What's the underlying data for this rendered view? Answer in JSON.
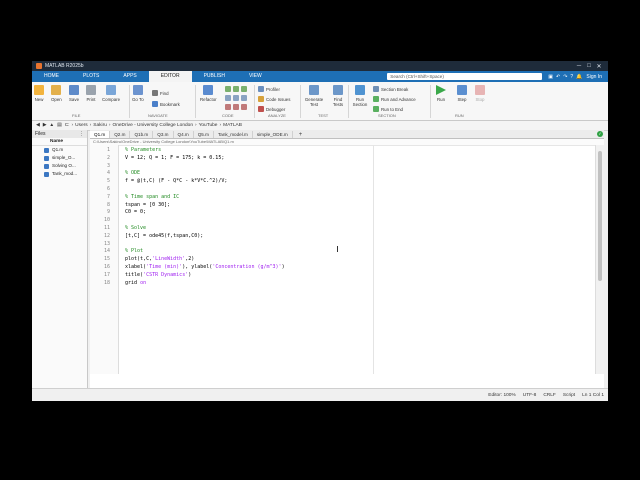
{
  "window": {
    "title": "MATLAB R2025b",
    "controls": [
      "─",
      "□",
      "✕"
    ]
  },
  "top_tabs": [
    {
      "label": "HOME",
      "active": false
    },
    {
      "label": "PLOTS",
      "active": false
    },
    {
      "label": "APPS",
      "active": false
    },
    {
      "label": "EDITOR",
      "active": true
    },
    {
      "label": "PUBLISH",
      "active": false
    },
    {
      "label": "VIEW",
      "active": false
    }
  ],
  "search": {
    "placeholder": "Search (Ctrl+Shift+Space)"
  },
  "signin": {
    "label": "Sign In"
  },
  "ribbon": {
    "file": {
      "new": "New",
      "open": "Open",
      "save": "Save",
      "print": "Print",
      "compare": "Compare",
      "section": "FILE"
    },
    "navigate": {
      "goto": "Go To",
      "find": "Find",
      "bookmark": "Bookmark",
      "section": "NAVIGATE"
    },
    "code": {
      "refactor": "Refactor",
      "section": "CODE"
    },
    "analyze": {
      "profiler": "Profiler",
      "code_issues": "Code Issues",
      "debugger": "Debugger",
      "section": "ANALYZE"
    },
    "test": {
      "generate": "Generate Test",
      "find_tests": "Find Tests",
      "section": "TEST"
    },
    "section_grp": {
      "run_section": "Run Section",
      "section_break": "Section Break",
      "run_advance": "Run and Advance",
      "run_end": "Run to End",
      "section": "SECTION"
    },
    "run": {
      "run": "Run",
      "step": "Step",
      "stop": "Stop",
      "section": "RUN"
    }
  },
  "address": {
    "crumbs": [
      "C:",
      "Users",
      "Sakiru",
      "OneDrive - University College London",
      "YouTube",
      "MATLAB"
    ]
  },
  "files_panel": {
    "title": "Files",
    "column": "Name",
    "items": [
      "Q1.m",
      "simple_O...",
      "Solving O...",
      "Tank_mod..."
    ]
  },
  "editor": {
    "tabs": [
      "Q1.m",
      "Q2.m",
      "Q1b.m",
      "Q3.m",
      "Q4.m",
      "Q5.m",
      "Tank_model.m",
      "simple_ODE.m"
    ],
    "active_tab": "Q1.m",
    "path": "C:\\Users\\Sakiru\\OneDrive - University College London\\YouTube\\MATLAB\\Q1.m",
    "lines": [
      "% Parameters",
      "V = 12; Q = 1; F = 175; k = 0.15;",
      "",
      "% ODE",
      "f = @(t,C) (F - Q*C - k*V*C.^2)/V;",
      "",
      "% Time span and IC",
      "tspan = [0 30];",
      "C0 = 0;",
      "",
      "% Solve",
      "[t,C] = ode45(f,tspan,C0);",
      "",
      "% Plot",
      "plot(t,C,'LineWidth',2)",
      "xlabel('Time (min)'), ylabel('Concentration (g/m^3)')",
      "title('CSTR Dynamics')",
      "grid on"
    ]
  },
  "status": {
    "zoom": "Editor: 100%",
    "encoding": "UTF-8",
    "eol": "CRLF",
    "type": "Script",
    "position": "Ln 1  Col 1"
  },
  "colors": {
    "tabstrip": "#1e6fb5",
    "titlebar": "#1e2b3a",
    "comment": "#228b22",
    "string": "#a020f0",
    "keyword": "#0000ff"
  }
}
